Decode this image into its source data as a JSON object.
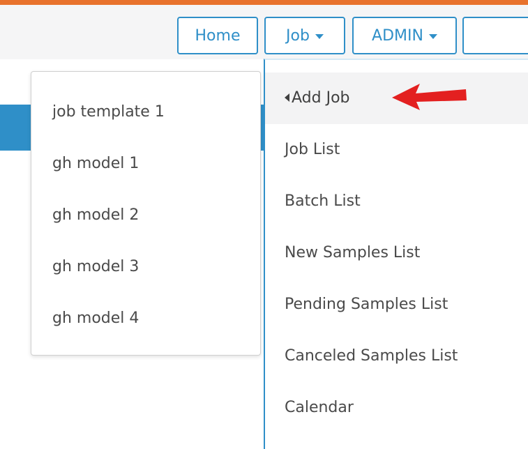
{
  "nav": {
    "home_label": "Home",
    "job_label": "Job",
    "admin_label": "ADMIN",
    "search_value": ""
  },
  "template_menu": {
    "items": [
      "job template 1",
      "gh model 1",
      "gh model 2",
      "gh model 3",
      "gh model 4"
    ]
  },
  "job_menu": {
    "items": [
      "Add Job",
      "Job List",
      "Batch List",
      "New Samples List",
      "Pending Samples List",
      "Canceled Samples List",
      "Calendar"
    ],
    "active_index": 0
  },
  "colors": {
    "accent": "#2f8fc8",
    "top_line": "#e8722d",
    "annotation_arrow": "#e32020"
  }
}
